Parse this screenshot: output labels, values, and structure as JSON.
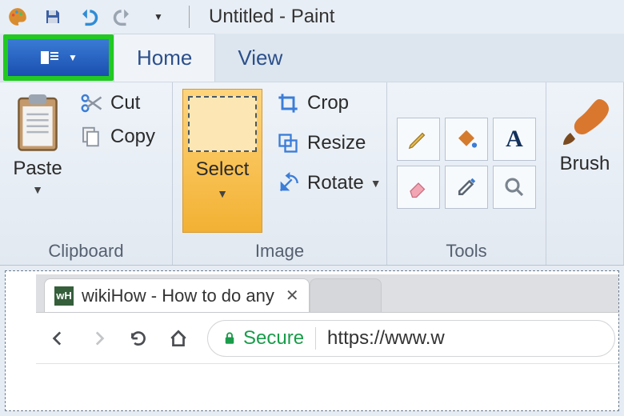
{
  "title": "Untitled - Paint",
  "quick_access": [
    "palette-icon",
    "save-icon",
    "undo-icon",
    "redo-icon",
    "customize-icon"
  ],
  "tabs": {
    "home": "Home",
    "view": "View"
  },
  "clipboard": {
    "paste": "Paste",
    "cut": "Cut",
    "copy": "Copy",
    "group_label": "Clipboard"
  },
  "image": {
    "select": "Select",
    "crop": "Crop",
    "resize": "Resize",
    "rotate": "Rotate",
    "group_label": "Image"
  },
  "tools": {
    "group_label": "Tools",
    "items": [
      "pencil-icon",
      "fill-icon",
      "text-icon",
      "eraser-icon",
      "picker-icon",
      "magnifier-icon"
    ]
  },
  "brushes": {
    "label": "Brush"
  },
  "browser": {
    "tab_title": "wikiHow - How to do any",
    "favicon_text": "wH",
    "secure_label": "Secure",
    "url": "https://www.w"
  }
}
